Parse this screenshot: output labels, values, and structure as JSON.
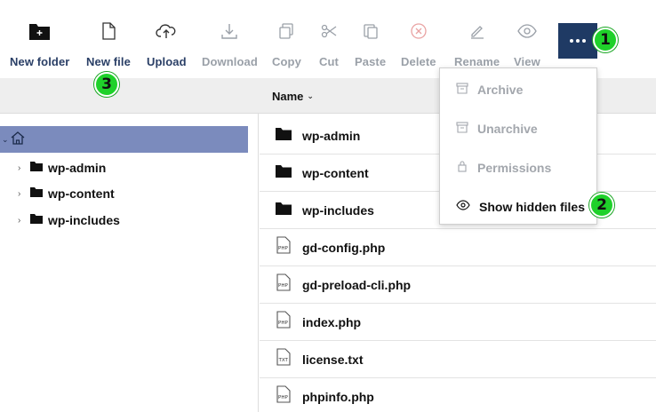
{
  "toolbar": {
    "buttons": [
      {
        "label": "New folder",
        "icon": "new-folder-icon"
      },
      {
        "label": "New file",
        "icon": "new-file-icon"
      },
      {
        "label": "Upload",
        "icon": "upload-icon"
      },
      {
        "label": "Download",
        "icon": "download-icon"
      },
      {
        "label": "Copy",
        "icon": "copy-icon"
      },
      {
        "label": "Cut",
        "icon": "scissors-icon"
      },
      {
        "label": "Paste",
        "icon": "paste-icon"
      },
      {
        "label": "Delete",
        "icon": "delete-icon"
      },
      {
        "label": "Rename",
        "icon": "pencil-icon"
      },
      {
        "label": "View",
        "icon": "eye-icon"
      }
    ],
    "more_icon": "ellipsis-icon",
    "accent_color": "#1f3a64"
  },
  "badges": [
    "1",
    "2",
    "3"
  ],
  "columns": {
    "name": "Name"
  },
  "tree": {
    "root_icon": "home-icon",
    "items": [
      {
        "label": "wp-admin"
      },
      {
        "label": "wp-content"
      },
      {
        "label": "wp-includes"
      }
    ]
  },
  "files": [
    {
      "name": "wp-admin",
      "type": "folder"
    },
    {
      "name": "wp-content",
      "type": "folder"
    },
    {
      "name": "wp-includes",
      "type": "folder"
    },
    {
      "name": "gd-config.php",
      "type": "PHP"
    },
    {
      "name": "gd-preload-cli.php",
      "type": "PHP"
    },
    {
      "name": "index.php",
      "type": "PHP"
    },
    {
      "name": "license.txt",
      "type": "TXT"
    },
    {
      "name": "phpinfo.php",
      "type": "PHP"
    }
  ],
  "menu": {
    "items": [
      {
        "label": "Archive",
        "icon": "archive-icon",
        "enabled": false
      },
      {
        "label": "Unarchive",
        "icon": "unarchive-icon",
        "enabled": false
      },
      {
        "label": "Permissions",
        "icon": "lock-icon",
        "enabled": false
      },
      {
        "label": "Show hidden files",
        "icon": "eye-icon",
        "enabled": true
      }
    ]
  },
  "colors": {
    "badge": "#1fd12a",
    "tree_selected": "#7b8bbd",
    "header_bg": "#eeeeee"
  }
}
